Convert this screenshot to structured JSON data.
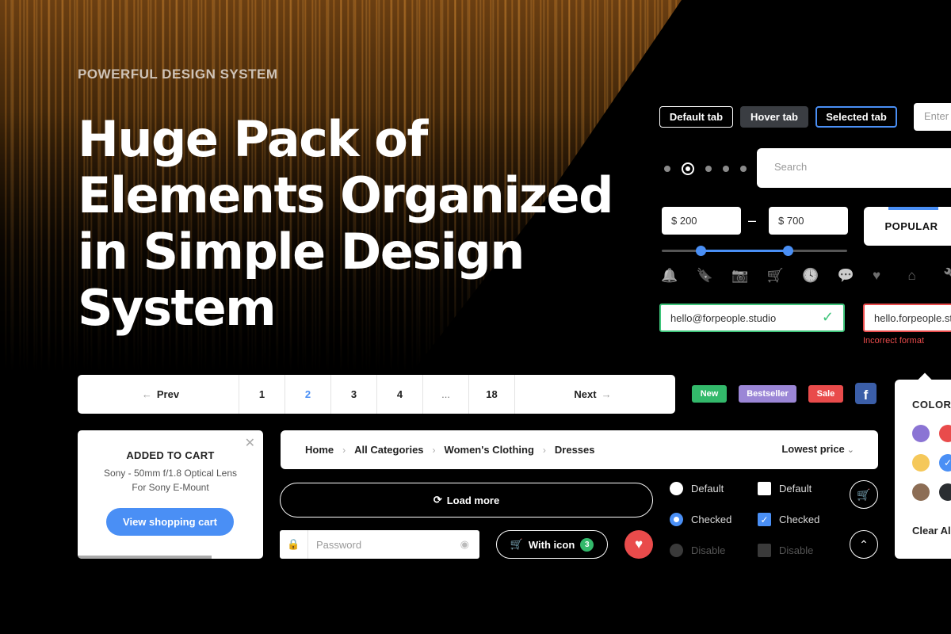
{
  "hero": {
    "eyebrow": "POWERFUL DESIGN SYSTEM",
    "headline_lines": [
      "Huge Pack of",
      "Elements Organized",
      "in Simple Design",
      "System"
    ]
  },
  "tabs": {
    "default": "Default tab",
    "hover": "Hover  tab",
    "selected": "Selected tab"
  },
  "enter_field": {
    "placeholder": "Enter"
  },
  "search": {
    "placeholder": "Search"
  },
  "price_range": {
    "min": "$ 200",
    "max": "$ 700",
    "separator": "–",
    "slider_min_fraction": 0.21,
    "slider_max_fraction": 0.68
  },
  "popular_tab": {
    "label": "POPULAR"
  },
  "icon_row": [
    {
      "name": "bell-icon",
      "glyph": "🔔"
    },
    {
      "name": "bookmark-icon",
      "glyph": "🔖"
    },
    {
      "name": "camera-icon",
      "glyph": "📷"
    },
    {
      "name": "cart-icon",
      "glyph": "🛒"
    },
    {
      "name": "clock-icon",
      "glyph": "🕓"
    },
    {
      "name": "chat-icon",
      "glyph": "💬"
    },
    {
      "name": "heart-icon",
      "glyph": "♥"
    },
    {
      "name": "home-icon",
      "glyph": "⌂"
    },
    {
      "name": "wrench-icon",
      "glyph": "🔧"
    }
  ],
  "email_valid": {
    "value": "hello@forpeople.studio"
  },
  "email_invalid": {
    "value": "hello.forpeople.studio",
    "error": "Incorrect format"
  },
  "pagination": {
    "prev": "Prev",
    "next": "Next",
    "pages": [
      "1",
      "2",
      "3",
      "4",
      "...",
      "18"
    ],
    "current": "2"
  },
  "badges": {
    "new": "New",
    "bestseller": "Bestseller",
    "sale": "Sale"
  },
  "facebook": {
    "glyph": "f"
  },
  "color_filter": {
    "title": "COLOR",
    "clear_label": "Clear All",
    "swatches": [
      "#8b74d4",
      "#e94b4b",
      "#f5c85a",
      "#4a8ff5",
      "#8c6d55",
      "#2a2d31"
    ]
  },
  "cart_notice": {
    "title": "ADDED TO CART",
    "desc_line1": "Sony - 50mm f/1.8 Optical Lens",
    "desc_line2": "For Sony E-Mount",
    "button": "View shopping cart"
  },
  "breadcrumb": {
    "items": [
      "Home",
      "All Categories",
      "Women's Clothing",
      "Dresses"
    ],
    "sort_label": "Lowest price"
  },
  "load_more": {
    "label": "Load more"
  },
  "password": {
    "placeholder": "Password"
  },
  "with_icon_button": {
    "label": "With icon",
    "count": "3"
  },
  "radios": {
    "default": "Default",
    "checked": "Checked",
    "disabled": "Disable"
  },
  "checkboxes": {
    "default": "Default",
    "checked": "Checked",
    "disabled": "Disable"
  },
  "colors": {
    "accent": "#4a8ff5",
    "success": "#33b96b",
    "danger": "#e94b4b",
    "purple": "#9b86d6"
  }
}
